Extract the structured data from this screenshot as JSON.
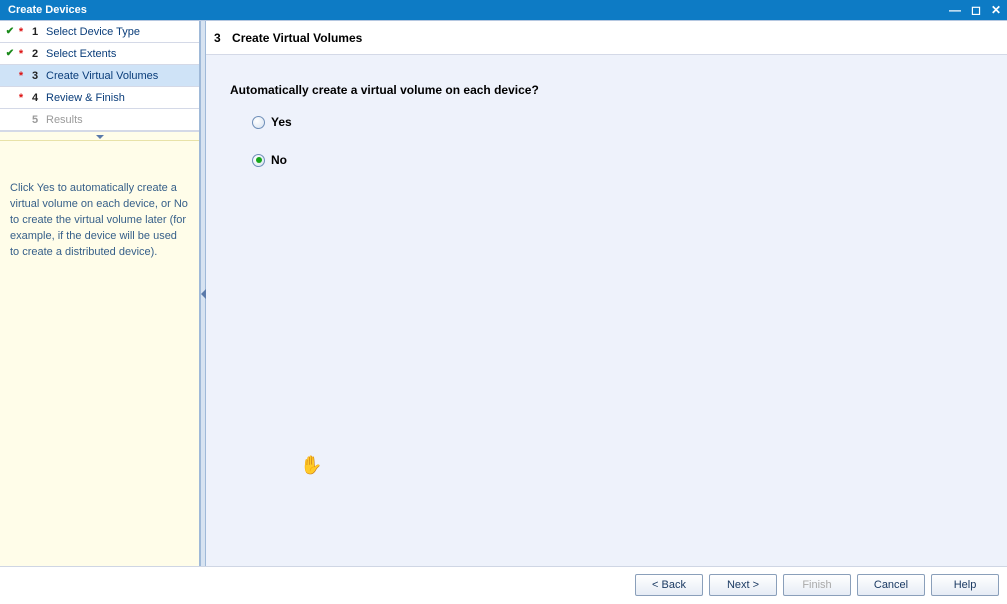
{
  "window": {
    "title": "Create Devices"
  },
  "steps": [
    {
      "num": "1",
      "label": "Select Device Type",
      "check": true,
      "required": true,
      "active": false,
      "disabled": false
    },
    {
      "num": "2",
      "label": "Select Extents",
      "check": true,
      "required": true,
      "active": false,
      "disabled": false
    },
    {
      "num": "3",
      "label": "Create Virtual Volumes",
      "check": false,
      "required": true,
      "active": true,
      "disabled": false
    },
    {
      "num": "4",
      "label": "Review & Finish",
      "check": false,
      "required": true,
      "active": false,
      "disabled": false
    },
    {
      "num": "5",
      "label": "Results",
      "check": false,
      "required": false,
      "active": false,
      "disabled": true
    }
  ],
  "help": {
    "text": "Click Yes to automatically create a virtual volume on each device, or No to create the virtual volume later (for example, if the device will be used to create a distributed device)."
  },
  "content": {
    "step_num": "3",
    "step_title": "Create Virtual Volumes",
    "question": "Automatically create a virtual volume on each device?",
    "options": {
      "yes": "Yes",
      "no": "No"
    },
    "selected": "no"
  },
  "footer": {
    "back": "< Back",
    "next": "Next >",
    "finish": "Finish",
    "cancel": "Cancel",
    "help": "Help"
  }
}
